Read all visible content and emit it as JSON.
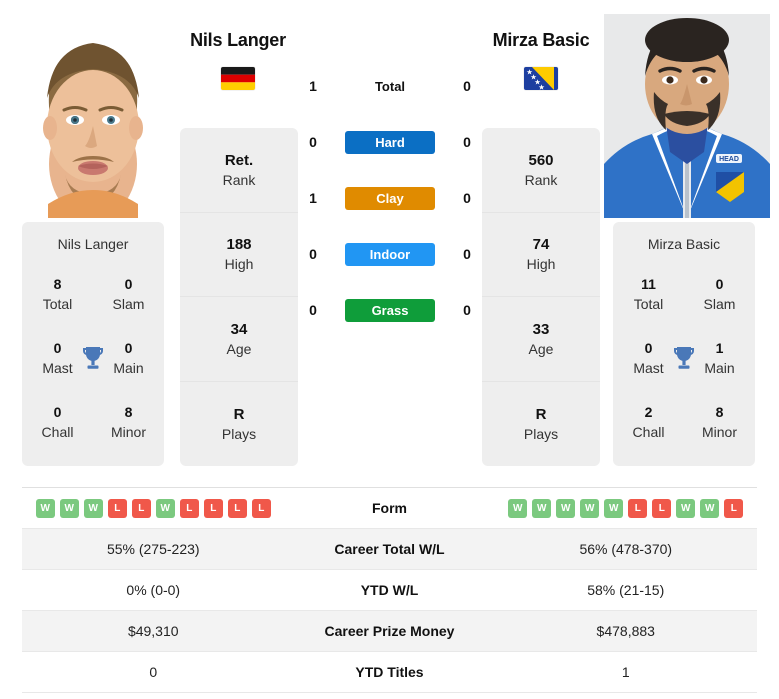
{
  "players": {
    "left": {
      "name": "Nils Langer",
      "flag": "germany-flag",
      "rank": {
        "value": "Ret.",
        "label": "Rank"
      },
      "high": {
        "value": "188",
        "label": "High"
      },
      "age": {
        "value": "34",
        "label": "Age"
      },
      "plays": {
        "value": "R",
        "label": "Plays"
      },
      "titles_card_name": "Nils Langer",
      "titles": [
        {
          "value": "8",
          "label": "Total"
        },
        {
          "value": "0",
          "label": "Slam"
        },
        {
          "value": "0",
          "label": "Mast"
        },
        {
          "value": "0",
          "label": "Main"
        },
        {
          "value": "0",
          "label": "Chall"
        },
        {
          "value": "8",
          "label": "Minor"
        }
      ],
      "form": [
        "W",
        "W",
        "W",
        "L",
        "L",
        "W",
        "L",
        "L",
        "L",
        "L"
      ],
      "career_total_wl": "55% (275-223)",
      "ytd_wl": "0% (0-0)",
      "career_prize_money": "$49,310",
      "ytd_titles": "0"
    },
    "right": {
      "name": "Mirza Basic",
      "flag": "bosnia-flag",
      "rank": {
        "value": "560",
        "label": "Rank"
      },
      "high": {
        "value": "74",
        "label": "High"
      },
      "age": {
        "value": "33",
        "label": "Age"
      },
      "plays": {
        "value": "R",
        "label": "Plays"
      },
      "titles_card_name": "Mirza Basic",
      "titles": [
        {
          "value": "11",
          "label": "Total"
        },
        {
          "value": "0",
          "label": "Slam"
        },
        {
          "value": "0",
          "label": "Mast"
        },
        {
          "value": "1",
          "label": "Main"
        },
        {
          "value": "2",
          "label": "Chall"
        },
        {
          "value": "8",
          "label": "Minor"
        }
      ],
      "form": [
        "W",
        "W",
        "W",
        "W",
        "W",
        "L",
        "L",
        "W",
        "W",
        "L"
      ],
      "career_total_wl": "56% (478-370)",
      "ytd_wl": "58% (21-15)",
      "career_prize_money": "$478,883",
      "ytd_titles": "1"
    }
  },
  "surfaces": [
    {
      "label": "Total",
      "left": "1",
      "right": "0",
      "color": ""
    },
    {
      "label": "Hard",
      "left": "0",
      "right": "0",
      "color": "#0b6fc4"
    },
    {
      "label": "Clay",
      "left": "1",
      "right": "0",
      "color": "#e08b00"
    },
    {
      "label": "Indoor",
      "left": "0",
      "right": "0",
      "color": "#2196f3"
    },
    {
      "label": "Grass",
      "left": "0",
      "right": "0",
      "color": "#0f9d3a"
    }
  ],
  "table_labels": {
    "form": "Form",
    "career_total_wl": "Career Total W/L",
    "ytd_wl": "YTD W/L",
    "career_prize_money": "Career Prize Money",
    "ytd_titles": "YTD Titles"
  },
  "colors": {
    "win_badge": "#7bc97f",
    "loss_badge": "#f0584a",
    "card_bg": "#eeeeee",
    "trophy": "#4a78b8"
  }
}
